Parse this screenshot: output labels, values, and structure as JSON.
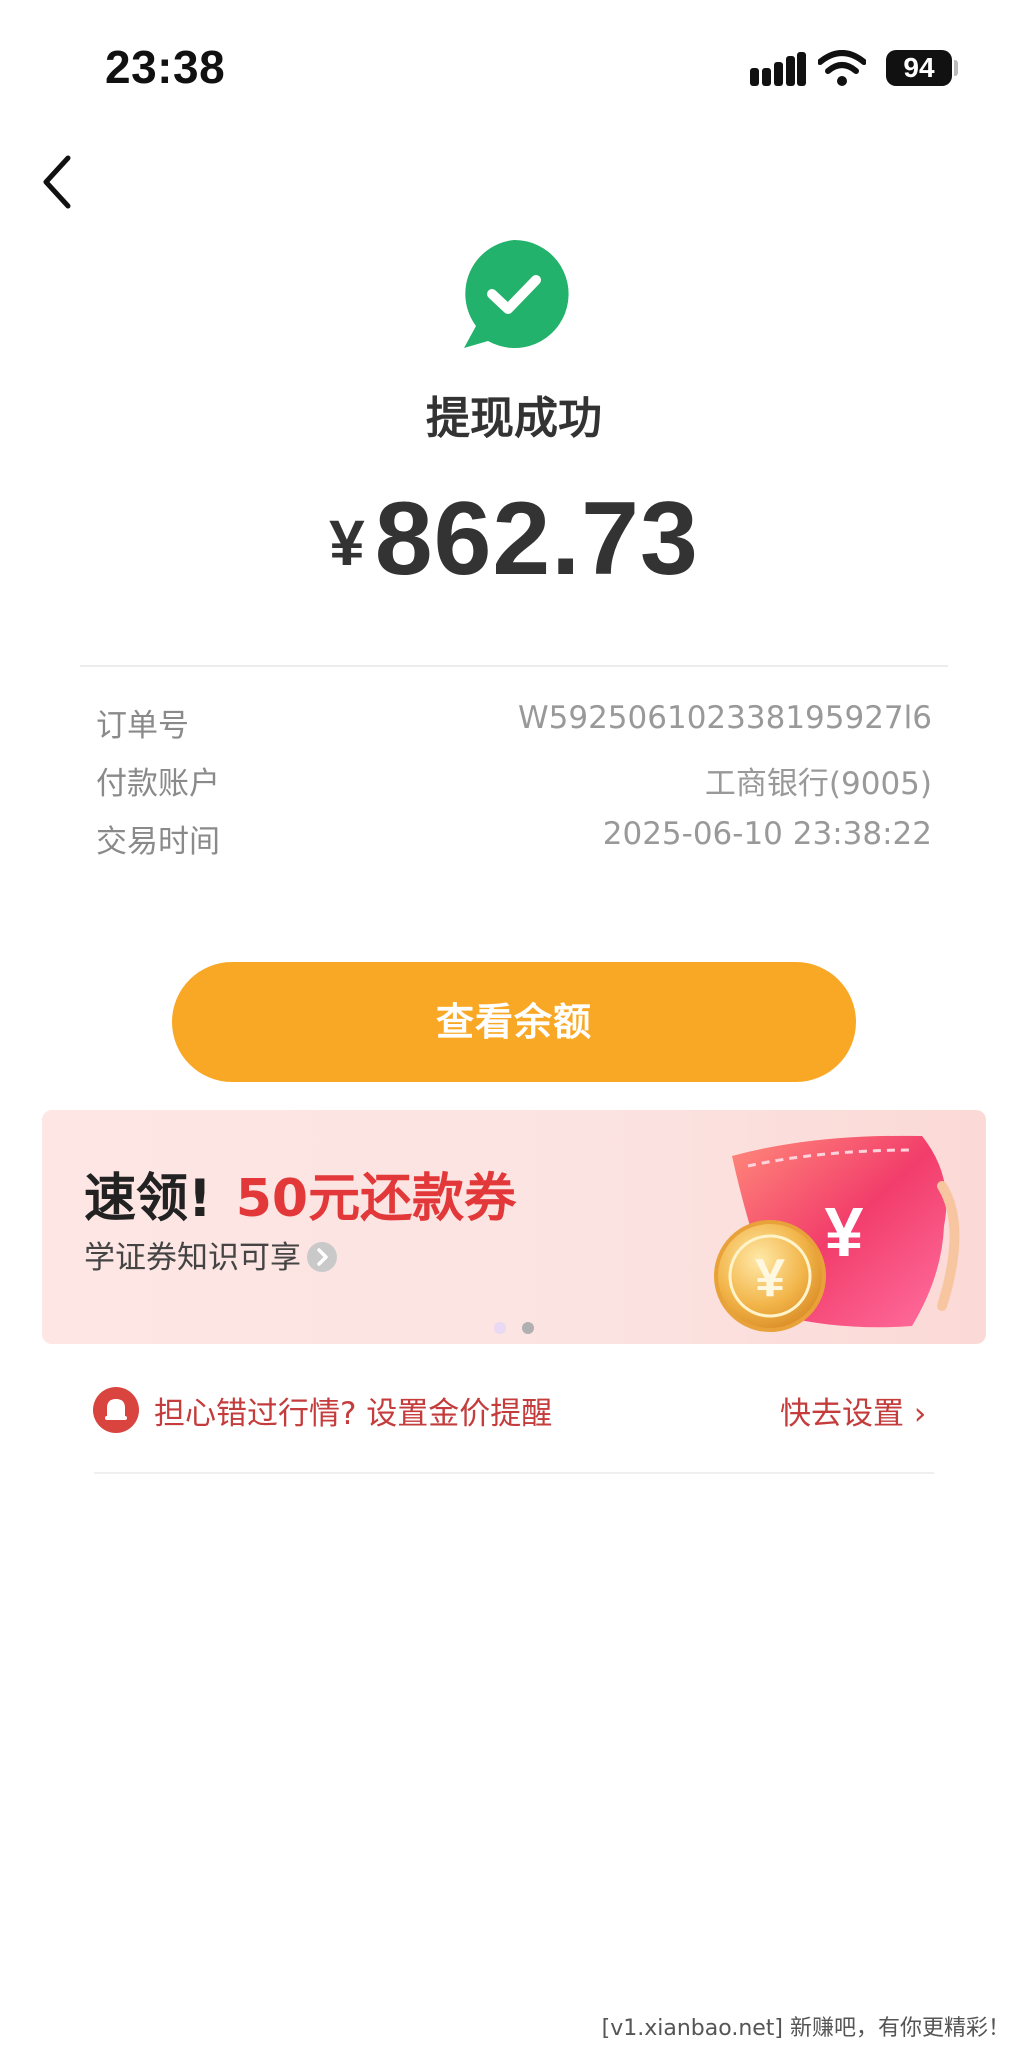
{
  "status_bar": {
    "time": "23:38",
    "battery": "94",
    "icons": [
      "signal-icon",
      "wifi-icon",
      "battery-icon"
    ]
  },
  "header": {
    "back_icon": "chevron-left-icon"
  },
  "result": {
    "icon": "success-check-icon",
    "icon_color": "#23b26b",
    "title": "提现成功",
    "currency_symbol": "¥",
    "amount": "862.73"
  },
  "details": [
    {
      "label": "订单号",
      "value": "W592506102338195927l6"
    },
    {
      "label": "付款账户",
      "value": "工商银行(9005)"
    },
    {
      "label": "交易时间",
      "value": "2025-06-10 23:38:22"
    }
  ],
  "actions": {
    "primary_label": "查看余额",
    "primary_color": "#f9a826"
  },
  "banner": {
    "title_a": "速领!",
    "title_b": "50元还款券",
    "title_b_color": "#e2383a",
    "subtitle": "学证券知识可享",
    "art_icons": [
      "coupon-icon",
      "yuan-coin-icon"
    ],
    "pagination": {
      "current": 1,
      "total": 2
    }
  },
  "reminder": {
    "icon": "alarm-bell-icon",
    "text": "担心错过行情? 设置金价提醒",
    "link_label": "快去设置 ›",
    "color": "#c43c3c"
  },
  "watermark": "[v1.xianbao.net] 新赚吧，有你更精彩！"
}
